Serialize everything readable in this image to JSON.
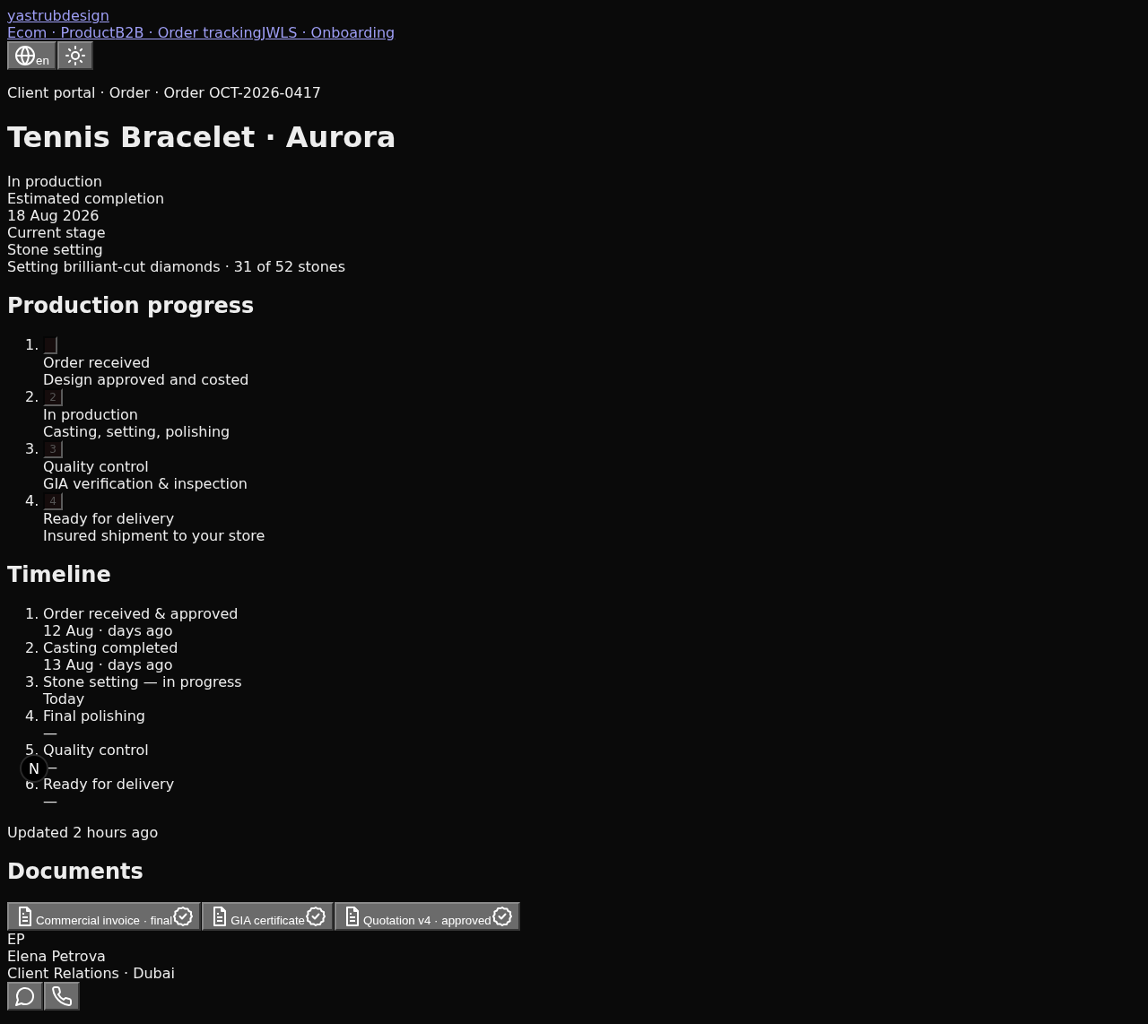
{
  "brand": "yastrubdesign",
  "nav_links": [
    "Ecom · Product",
    "B2B · Order tracking",
    "JWLS · Onboarding"
  ],
  "toolbar": {
    "language": "en"
  },
  "breadcrumb": "Client portal · Order · Order OCT-2026-0417",
  "title": "Tennis Bracelet · Aurora",
  "summary": {
    "status": "In production",
    "eta_label": "Estimated completion",
    "eta_value": "18 Aug 2026",
    "stage_label": "Current stage",
    "stage_value": "Stone setting",
    "stage_detail": "Setting brilliant-cut diamonds · 31 of 52 stones"
  },
  "progress": {
    "heading": "Production progress",
    "steps": [
      {
        "marker": "1.",
        "done": true,
        "title": "Order received",
        "detail": "Design approved and costed"
      },
      {
        "marker": "2.",
        "done": false,
        "number": "2",
        "title": "In production",
        "detail": "Casting, setting, polishing"
      },
      {
        "marker": "3.",
        "done": false,
        "number": "3",
        "title": "Quality control",
        "detail": "GIA verification & inspection"
      },
      {
        "marker": "4.",
        "done": false,
        "number": "4",
        "title": "Ready for delivery",
        "detail": "Insured shipment to your store"
      }
    ]
  },
  "timeline": {
    "heading": "Timeline",
    "events": [
      {
        "marker": "1.",
        "title": "Order received & approved",
        "when": "12 Aug · days ago"
      },
      {
        "marker": "2.",
        "title": "Casting completed",
        "when": "13 Aug · days ago"
      },
      {
        "marker": "3.",
        "title": "Stone setting — in progress",
        "when": "Today"
      },
      {
        "marker": "4.",
        "title": "Final polishing",
        "when": "—"
      },
      {
        "marker": "5.",
        "title": "Quality control",
        "when": "—"
      },
      {
        "marker": "6.",
        "title": "Ready for delivery",
        "when": "—"
      }
    ],
    "updated": "Updated 2 hours ago"
  },
  "documents": {
    "heading": "Documents",
    "items": [
      {
        "label": "Commercial invoice · final",
        "verified": true
      },
      {
        "label": "GIA certificate",
        "verified": true
      },
      {
        "label": "Quotation v4 · approved",
        "verified": true
      }
    ]
  },
  "contact": {
    "initials": "EP",
    "name": "Elena Petrova",
    "role": "Client Relations · Dubai"
  },
  "dev_badge": "N"
}
